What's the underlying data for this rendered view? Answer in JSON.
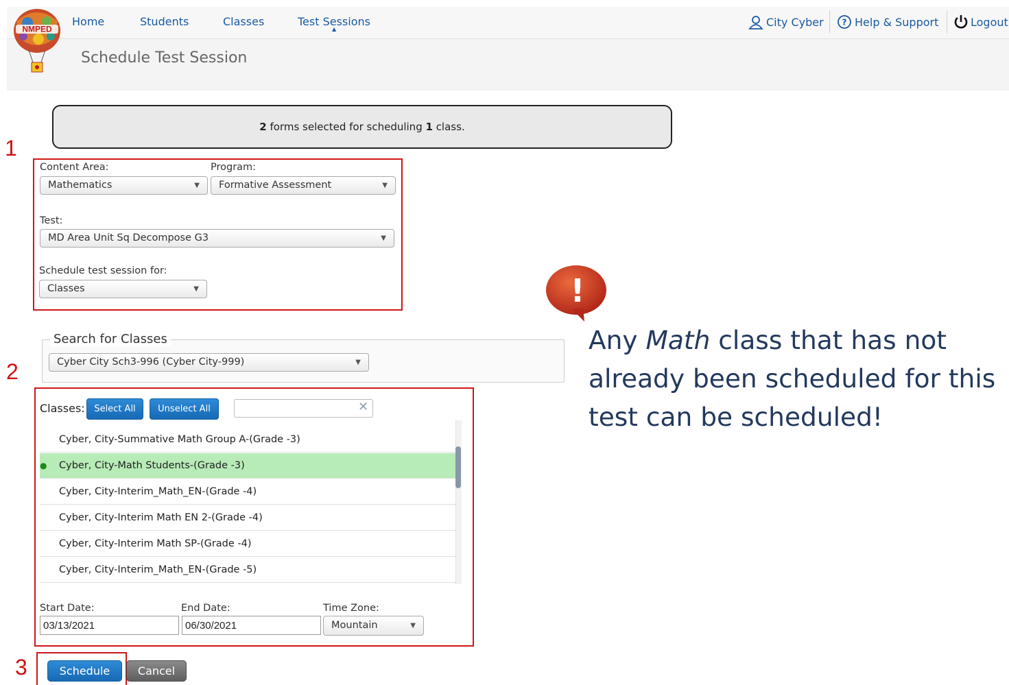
{
  "nav": {
    "logo_text": "NMPED",
    "items": [
      "Home",
      "Students",
      "Classes",
      "Test Sessions"
    ],
    "user": "City Cyber",
    "help": "Help & Support",
    "logout": "Logout"
  },
  "page_title": "Schedule Test Session",
  "summary": {
    "forms_count": "2",
    "forms_text": " forms selected for scheduling ",
    "class_count": "1",
    "class_text": " class."
  },
  "steps": [
    "1",
    "2",
    "3"
  ],
  "form": {
    "content_area_label": "Content Area:",
    "content_area_value": "Mathematics",
    "program_label": "Program:",
    "program_value": "Formative Assessment",
    "test_label": "Test:",
    "test_value": "MD Area Unit Sq Decompose G3",
    "schedule_for_label": "Schedule test session for:",
    "schedule_for_value": "Classes"
  },
  "search": {
    "legend": "Search for Classes",
    "school_value": "Cyber City Sch3-996 (Cyber City-999)"
  },
  "classes": {
    "label": "Classes:",
    "select_all": "Select All",
    "unselect_all": "Unselect All",
    "filter_value": "",
    "rows": [
      {
        "name": "Cyber, City-Summative Math Group A-(Grade -3)",
        "selected": false
      },
      {
        "name": "Cyber, City-Math Students-(Grade -3)",
        "selected": true
      },
      {
        "name": "Cyber, City-Interim_Math_EN-(Grade -4)",
        "selected": false
      },
      {
        "name": "Cyber, City-Interim Math EN 2-(Grade -4)",
        "selected": false
      },
      {
        "name": "Cyber, City-Interim Math SP-(Grade -4)",
        "selected": false
      },
      {
        "name": "Cyber, City-Interim_Math_EN-(Grade -5)",
        "selected": false
      }
    ]
  },
  "dates": {
    "start_label": "Start Date:",
    "start_value": "03/13/2021",
    "end_label": "End Date:",
    "end_value": "06/30/2021",
    "tz_label": "Time Zone:",
    "tz_value": "Mountain"
  },
  "buttons": {
    "schedule": "Schedule",
    "cancel": "Cancel"
  },
  "callout": {
    "part1": "Any ",
    "part2_italic": "Math",
    "part3": " class that has not already been scheduled for this test can be scheduled!",
    "icon_glyph": "!"
  },
  "colors": {
    "nav_link": "#1a5aa3",
    "annotation_red": "#d01515",
    "selected_row": "#b7ebb7",
    "button_blue": "#1e78c8",
    "callout_text": "#23395d"
  }
}
